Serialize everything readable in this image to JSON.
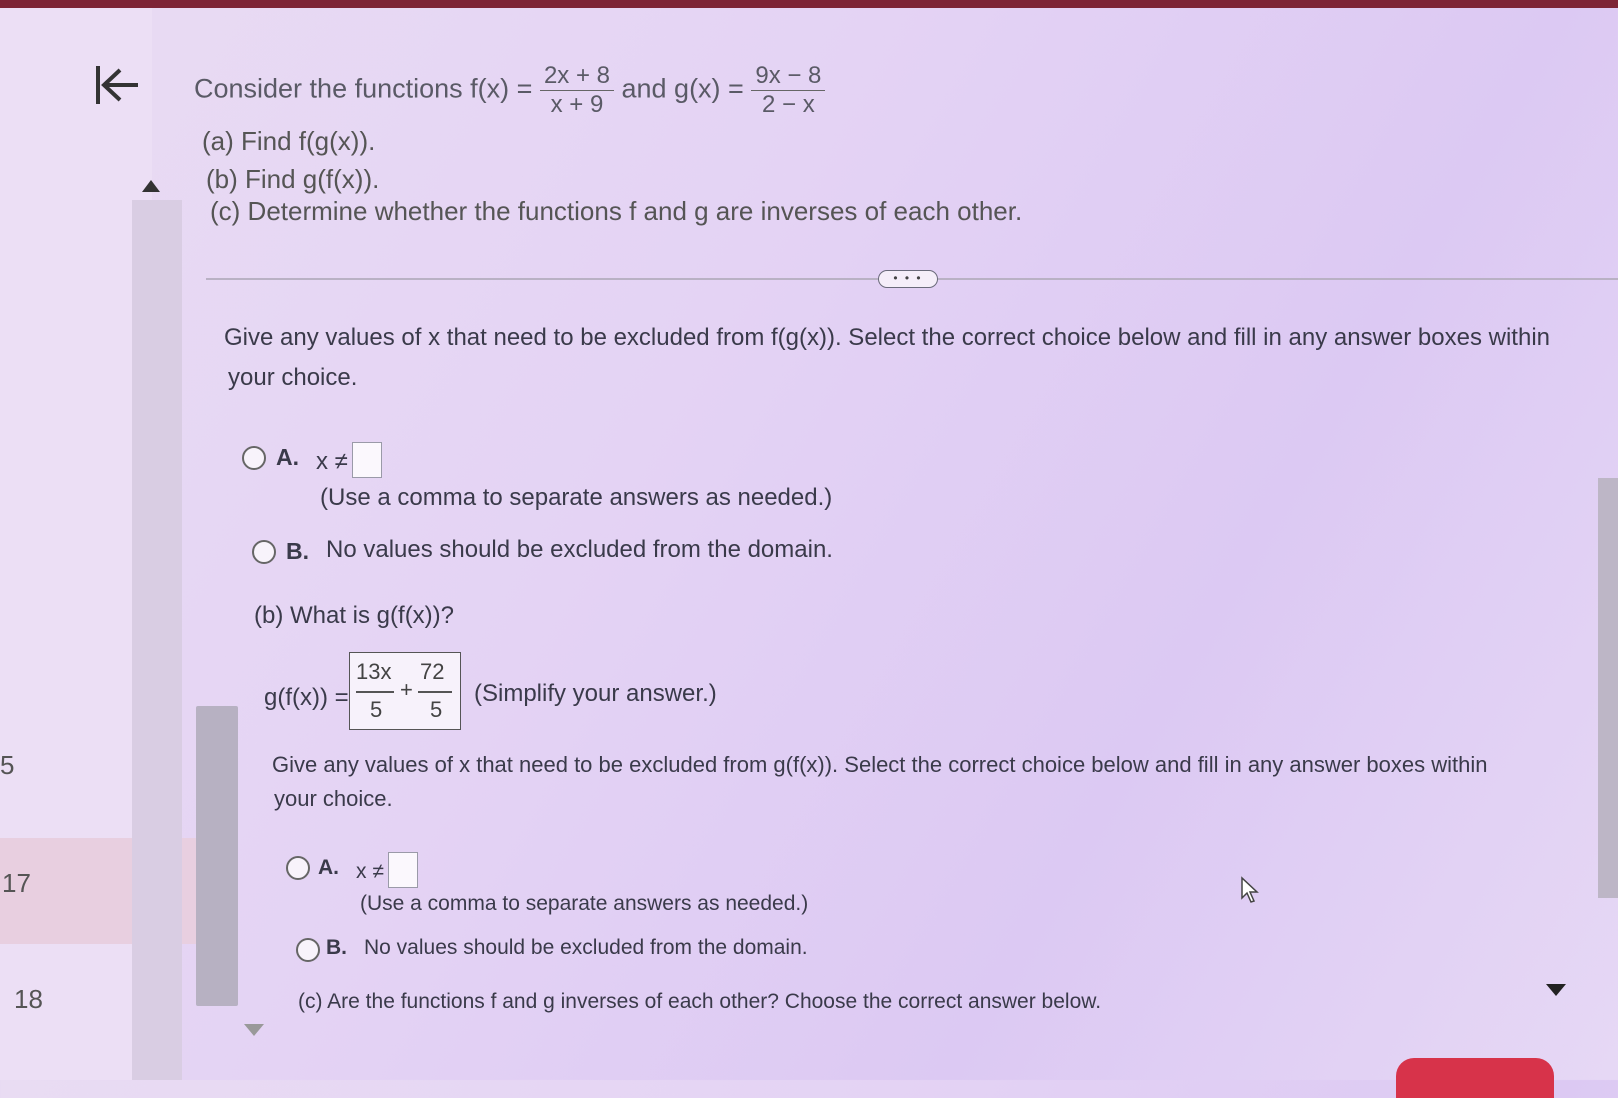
{
  "nav": {
    "items": [
      "5",
      "17",
      "18"
    ]
  },
  "question": {
    "intro": "Consider the functions f(x) =",
    "f_num": "2x + 8",
    "f_den": "x + 9",
    "and": "and g(x) =",
    "g_num": "9x − 8",
    "g_den": "2 − x",
    "parts": [
      "(a) Find f(g(x)).",
      "(b) Find g(f(x)).",
      "(c) Determine whether the functions f and g are inverses of each other."
    ]
  },
  "more_label": "• • •",
  "section_a": {
    "prompt_line1": "Give any values of x that need to be excluded from f(g(x)). Select the correct choice below and fill in any answer boxes within",
    "prompt_line2": "your choice.",
    "option_a_letter": "A.",
    "option_a_expr": "x ≠",
    "option_a_hint": "(Use a comma to separate answers as needed.)",
    "option_b_letter": "B.",
    "option_b_text": "No values should be excluded from the domain."
  },
  "section_b": {
    "question": "(b) What is g(f(x))?",
    "lhs": "g(f(x)) =",
    "frac1_num": "13x",
    "frac1_den": "5",
    "plus": "+",
    "frac2_num": "72",
    "frac2_den": "5",
    "hint": "(Simplify your answer.)",
    "prompt_line1": "Give any values of x that need to be excluded from g(f(x)). Select the correct choice below and fill in any answer boxes within",
    "prompt_line2": "your choice.",
    "option_a_letter": "A.",
    "option_a_expr": "x ≠",
    "option_a_hint": "(Use a comma to separate answers as needed.)",
    "option_b_letter": "B.",
    "option_b_text": "No values should be excluded from the domain."
  },
  "section_c": {
    "question": "(c) Are the functions f and g inverses of each other? Choose the correct answer below."
  }
}
